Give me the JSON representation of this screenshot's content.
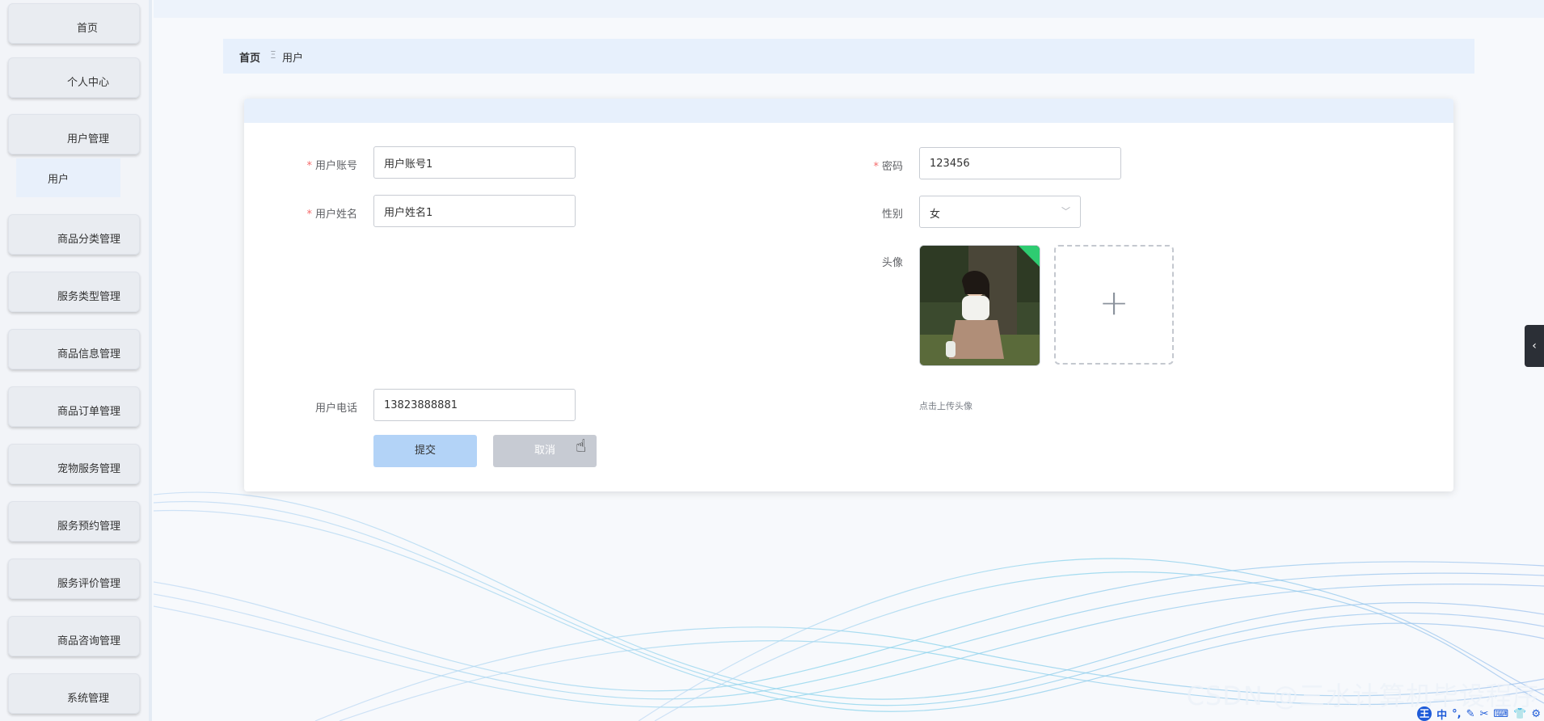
{
  "sidebar": {
    "items": [
      {
        "label": "首页"
      },
      {
        "label": "个人中心"
      },
      {
        "label": "用户管理"
      },
      {
        "label": "商品分类管理"
      },
      {
        "label": "服务类型管理"
      },
      {
        "label": "商品信息管理"
      },
      {
        "label": "商品订单管理"
      },
      {
        "label": "宠物服务管理"
      },
      {
        "label": "服务预约管理"
      },
      {
        "label": "服务评价管理"
      },
      {
        "label": "商品咨询管理"
      },
      {
        "label": "系统管理"
      }
    ],
    "sub_item": {
      "label": "用户"
    }
  },
  "breadcrumb": {
    "home": "首页",
    "separator": "Ξ",
    "current": "用户"
  },
  "form": {
    "account": {
      "label": "用户账号",
      "value": "用户账号1",
      "required": true
    },
    "name": {
      "label": "用户姓名",
      "value": "用户姓名1",
      "required": true
    },
    "password": {
      "label": "密码",
      "value": "123456",
      "required": true
    },
    "gender": {
      "label": "性别",
      "value": "女"
    },
    "avatar": {
      "label": "头像",
      "hint": "点击上传头像"
    },
    "phone": {
      "label": "用户电话",
      "value": "13823888881"
    },
    "required_mark": "*",
    "submit_label": "提交",
    "cancel_label": "取消"
  },
  "watermark": "CSDN @三水计算机毕设程序",
  "ime": {
    "badge": "王",
    "mode": "中"
  },
  "colors": {
    "accent": "#b3d3f7",
    "header_bg": "#e7f0fc",
    "required": "#f56c6c"
  }
}
